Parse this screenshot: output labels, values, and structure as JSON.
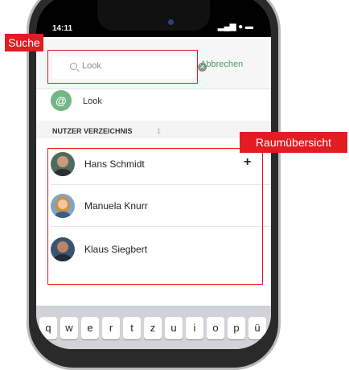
{
  "status_bar": {
    "time": "14:11",
    "icons": "▂▄▆ ● ▬"
  },
  "search": {
    "value": "Look",
    "cancel_label": "Abbrechen"
  },
  "suggestion": {
    "label": "Look",
    "icon": "@"
  },
  "directory": {
    "title": "NUTZER VERZEICHNIS",
    "count": "1",
    "users": [
      {
        "name": "Hans Schmidt",
        "action": "+"
      },
      {
        "name": "Manuela Knurr"
      },
      {
        "name": "Klaus Siegbert"
      }
    ]
  },
  "keyboard": {
    "keys": [
      "q",
      "w",
      "e",
      "r",
      "t",
      "z",
      "u",
      "i",
      "o",
      "p",
      "ü"
    ]
  },
  "annotations": {
    "search_label": "Suche",
    "overview_label": "Raumübersicht"
  },
  "colors": {
    "annotation": "#e31b23",
    "accent_green": "#4b9b68",
    "at_icon": "#72b886"
  }
}
